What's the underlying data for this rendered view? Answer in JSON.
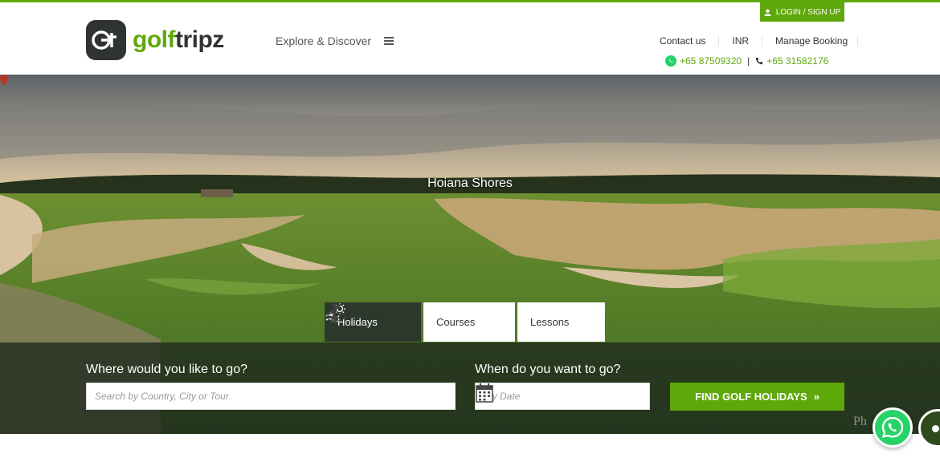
{
  "colors": {
    "brand_green": "#5fa80b",
    "dark": "#2f3430",
    "tab_active": "#2d382d"
  },
  "header": {
    "login_label": "LOGIN / SIGN UP",
    "logo_mark": "Gt",
    "logo_part1": "golf",
    "logo_part2": "tripz",
    "explore_label": "Explore & Discover",
    "nav": {
      "contact": "Contact us",
      "currency": "INR",
      "manage": "Manage Booking"
    },
    "whatsapp_phone": "+65 87509320",
    "separator": "|",
    "phone": "+65 31582176"
  },
  "hero": {
    "title": "Hoiana Shores",
    "tabs": [
      {
        "label": "Holidays",
        "icon": "holiday-icon",
        "active": true
      },
      {
        "label": "Courses",
        "icon": "course-icon",
        "active": false
      },
      {
        "label": "Lessons",
        "icon": "golfer-icon",
        "active": false
      }
    ],
    "where_label": "Where would you like to go?",
    "where_placeholder": "Search by Country, City or Tour",
    "when_label": "When do you want to go?",
    "when_placeholder": "Any Date",
    "find_label": "FIND GOLF HOLIDAYS",
    "find_arrow": "»",
    "photo_credit": "Ph"
  }
}
